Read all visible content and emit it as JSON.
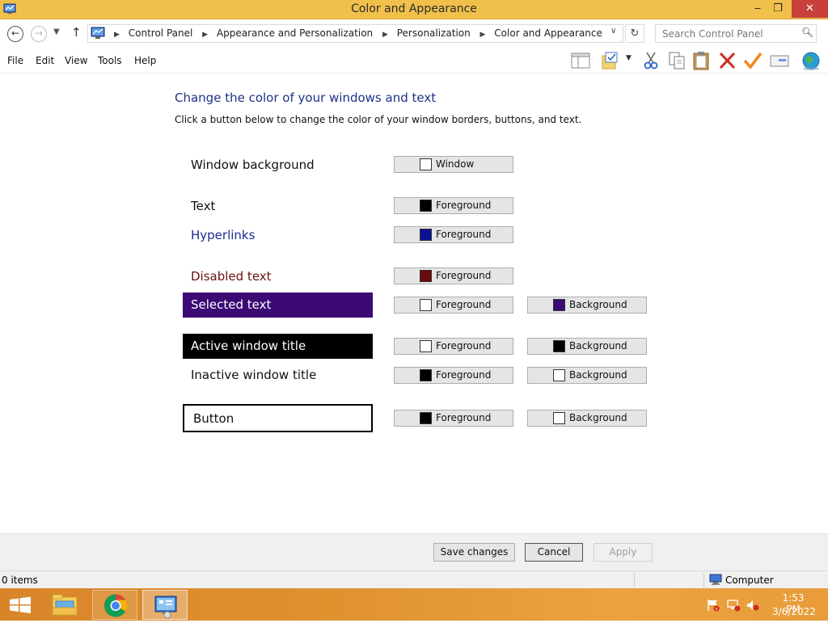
{
  "window": {
    "title": "Color and Appearance"
  },
  "titlebar_buttons": {
    "minimize": "‒",
    "maximize": "❐",
    "close": "✕"
  },
  "address": {
    "crumbs": [
      "Control Panel",
      "Appearance and Personalization",
      "Personalization",
      "Color and Appearance"
    ],
    "separator": "▶"
  },
  "search": {
    "placeholder": "Search Control Panel"
  },
  "menu": {
    "file": "File",
    "edit": "Edit",
    "view": "View",
    "tools": "Tools",
    "help": "Help"
  },
  "toolbar_icons": [
    "layout-pane-icon",
    "folder-check-icon",
    "cut-icon",
    "copy-icon",
    "paste-icon",
    "delete-icon",
    "checkmark-icon",
    "properties-icon",
    "globe-icon"
  ],
  "main": {
    "heading": "Change the color of your windows and text",
    "subheading": "Click a button below to change the color of your window borders, buttons, and text."
  },
  "rows": [
    {
      "label": "Window background",
      "label_color": "#111111",
      "label_bg": "",
      "buttons": [
        {
          "text": "Window",
          "swatch": "#ffffff"
        }
      ]
    },
    {
      "label": "Text",
      "label_color": "#111111",
      "label_bg": "",
      "buttons": [
        {
          "text": "Foreground",
          "swatch": "#000000"
        }
      ]
    },
    {
      "label": "Hyperlinks",
      "label_color": "#1e2a8f",
      "label_bg": "",
      "buttons": [
        {
          "text": "Foreground",
          "swatch": "#0a1296"
        }
      ]
    },
    {
      "label": "Disabled text",
      "label_color": "#6b1010",
      "label_bg": "",
      "buttons": [
        {
          "text": "Foreground",
          "swatch": "#6b0a0a"
        }
      ]
    },
    {
      "label": "Selected text",
      "label_color": "#ffffff",
      "label_bg": "#3b0a75",
      "buttons": [
        {
          "text": "Foreground",
          "swatch": "#ffffff"
        },
        {
          "text": "Background",
          "swatch": "#3b0a75"
        }
      ]
    },
    {
      "label": "Active window title",
      "label_color": "#ffffff",
      "label_bg": "#000000",
      "buttons": [
        {
          "text": "Foreground",
          "swatch": "#ffffff"
        },
        {
          "text": "Background",
          "swatch": "#000000"
        }
      ]
    },
    {
      "label": "Inactive window title",
      "label_color": "#111111",
      "label_bg": "",
      "buttons": [
        {
          "text": "Foreground",
          "swatch": "#000000"
        },
        {
          "text": "Background",
          "swatch": "#ffffff"
        }
      ]
    },
    {
      "label": "Button",
      "label_color": "#111111",
      "label_bg": "#ffffff",
      "buttons": [
        {
          "text": "Foreground",
          "swatch": "#000000"
        },
        {
          "text": "Background",
          "swatch": "#ffffff"
        }
      ]
    }
  ],
  "footer": {
    "save": "Save changes",
    "cancel": "Cancel",
    "apply": "Apply"
  },
  "status": {
    "items": "0 items",
    "location": "Computer"
  },
  "taskbar": {
    "time": "1:53 PM",
    "date": "3/6/2022"
  },
  "colors": {
    "titlebar": "#f0c04b",
    "heading": "#1e3287",
    "taskbar": "#e0922f",
    "close_button": "#c7403a"
  }
}
